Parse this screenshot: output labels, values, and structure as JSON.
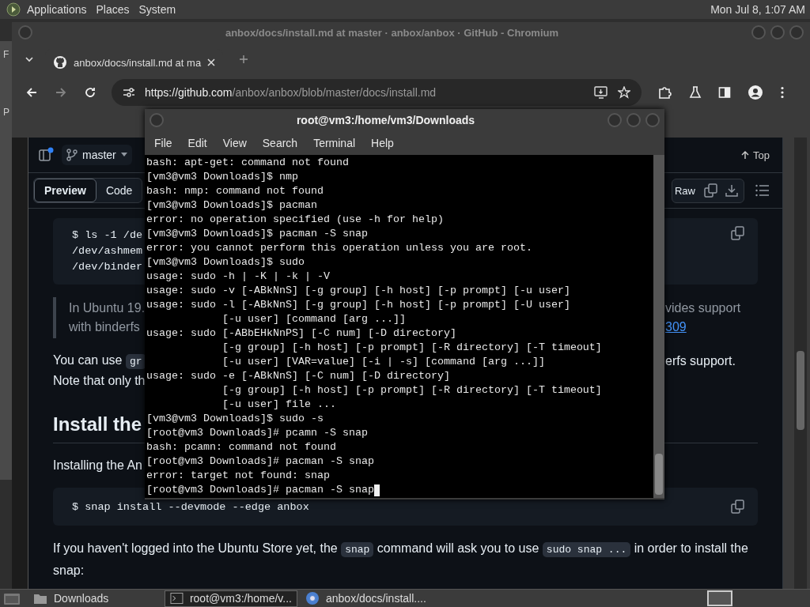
{
  "top_panel": {
    "menus": [
      "Applications",
      "Places",
      "System"
    ],
    "clock": "Mon Jul  8,  1:07 AM"
  },
  "background_window": {
    "letters": [
      "F",
      "P"
    ]
  },
  "browser": {
    "title": "anbox/docs/install.md at master · anbox/anbox · GitHub - Chromium",
    "tabs": [
      {
        "label": "anbox/docs/install.md at ma",
        "selected": true
      }
    ],
    "nav": [
      {
        "kind": "back",
        "disabled": false
      },
      {
        "kind": "forward",
        "disabled": true
      },
      {
        "kind": "reload",
        "disabled": false
      }
    ],
    "url_host": "https://github.com",
    "url_path": "/anbox/anbox/blob/master/docs/install.md"
  },
  "file_header": {
    "branch": "master",
    "top": "Top",
    "raw": "Raw",
    "view_tabs": [
      {
        "label": "Preview",
        "selected": true
      },
      {
        "label": "Code",
        "selected": false
      }
    ]
  },
  "markdown": [
    {
      "kind": "code",
      "lines": [
        {
          "left": [
            {
              "text": "$ ls -1 /de"
            }
          ]
        },
        {
          "left": [
            {
              "text": "/dev/ashmem"
            }
          ]
        },
        {
          "left": [
            {
              "text": "/dev/binder"
            }
          ]
        }
      ]
    },
    {
      "kind": "quote",
      "lines": [
        {
          "left": [
            {
              "text": "In Ubuntu 19."
            }
          ],
          "right": [
            {
              "text": "vides support"
            }
          ]
        },
        {
          "left": [
            {
              "text": "with binderfs"
            }
          ],
          "right": [
            {
              "link": "309"
            }
          ]
        }
      ]
    },
    {
      "kind": "para",
      "lines": [
        {
          "left": [
            {
              "text": "You can use "
            },
            {
              "code": "gr"
            }
          ],
          "right": [
            {
              "text": "erfs support."
            }
          ]
        },
        {
          "left": [
            {
              "text": "Note that only th"
            }
          ]
        }
      ]
    },
    {
      "kind": "heading",
      "lines": [
        {
          "left": [
            {
              "text": "Install the"
            }
          ]
        }
      ]
    },
    {
      "kind": "para",
      "lines": [
        {
          "left": [
            {
              "text": "Installing the An"
            }
          ]
        }
      ]
    },
    {
      "kind": "code_full",
      "parts": [
        {
          "text": "$ snap install --devmode --edge anbox"
        }
      ]
    },
    {
      "kind": "para_full",
      "parts": [
        {
          "text": "If you haven't logged into the Ubuntu Store yet, the "
        },
        {
          "code": "snap"
        },
        {
          "text": " command will ask you to use "
        },
        {
          "code": "sudo snap ..."
        },
        {
          "text": " in order to install the snap:"
        }
      ]
    }
  ],
  "terminal": {
    "title": "root@vm3:/home/vm3/Downloads",
    "menus": [
      "File",
      "Edit",
      "View",
      "Search",
      "Terminal",
      "Help"
    ],
    "lines": [
      "bash: apt-get: command not found",
      "[vm3@vm3 Downloads]$ nmp",
      "bash: nmp: command not found",
      "[vm3@vm3 Downloads]$ pacman",
      "error: no operation specified (use -h for help)",
      "[vm3@vm3 Downloads]$ pacman -S snap",
      "error: you cannot perform this operation unless you are root.",
      "[vm3@vm3 Downloads]$ sudo",
      "usage: sudo -h | -K | -k | -V",
      "usage: sudo -v [-ABkNnS] [-g group] [-h host] [-p prompt] [-u user]",
      "usage: sudo -l [-ABkNnS] [-g group] [-h host] [-p prompt] [-U user]",
      "            [-u user] [command [arg ...]]",
      "usage: sudo [-ABbEHkNnPS] [-C num] [-D directory]",
      "            [-g group] [-h host] [-p prompt] [-R directory] [-T timeout]",
      "            [-u user] [VAR=value] [-i | -s] [command [arg ...]]",
      "usage: sudo -e [-ABkNnS] [-C num] [-D directory]",
      "            [-g group] [-h host] [-p prompt] [-R directory] [-T timeout]",
      "            [-u user] file ...",
      "[vm3@vm3 Downloads]$ sudo -s",
      "[root@vm3 Downloads]# pcamn -S snap",
      "bash: pcamn: command not found",
      "[root@vm3 Downloads]# pacman -S snap",
      "error: target not found: snap",
      "[root@vm3 Downloads]# pacman -S snap"
    ]
  },
  "taskbar": {
    "items": [
      {
        "kind": "folder",
        "label": "Downloads",
        "selected": false
      },
      {
        "kind": "terminal",
        "label": "root@vm3:/home/v...",
        "selected": true
      },
      {
        "kind": "browser",
        "label": "anbox/docs/install....",
        "selected": false
      }
    ]
  }
}
